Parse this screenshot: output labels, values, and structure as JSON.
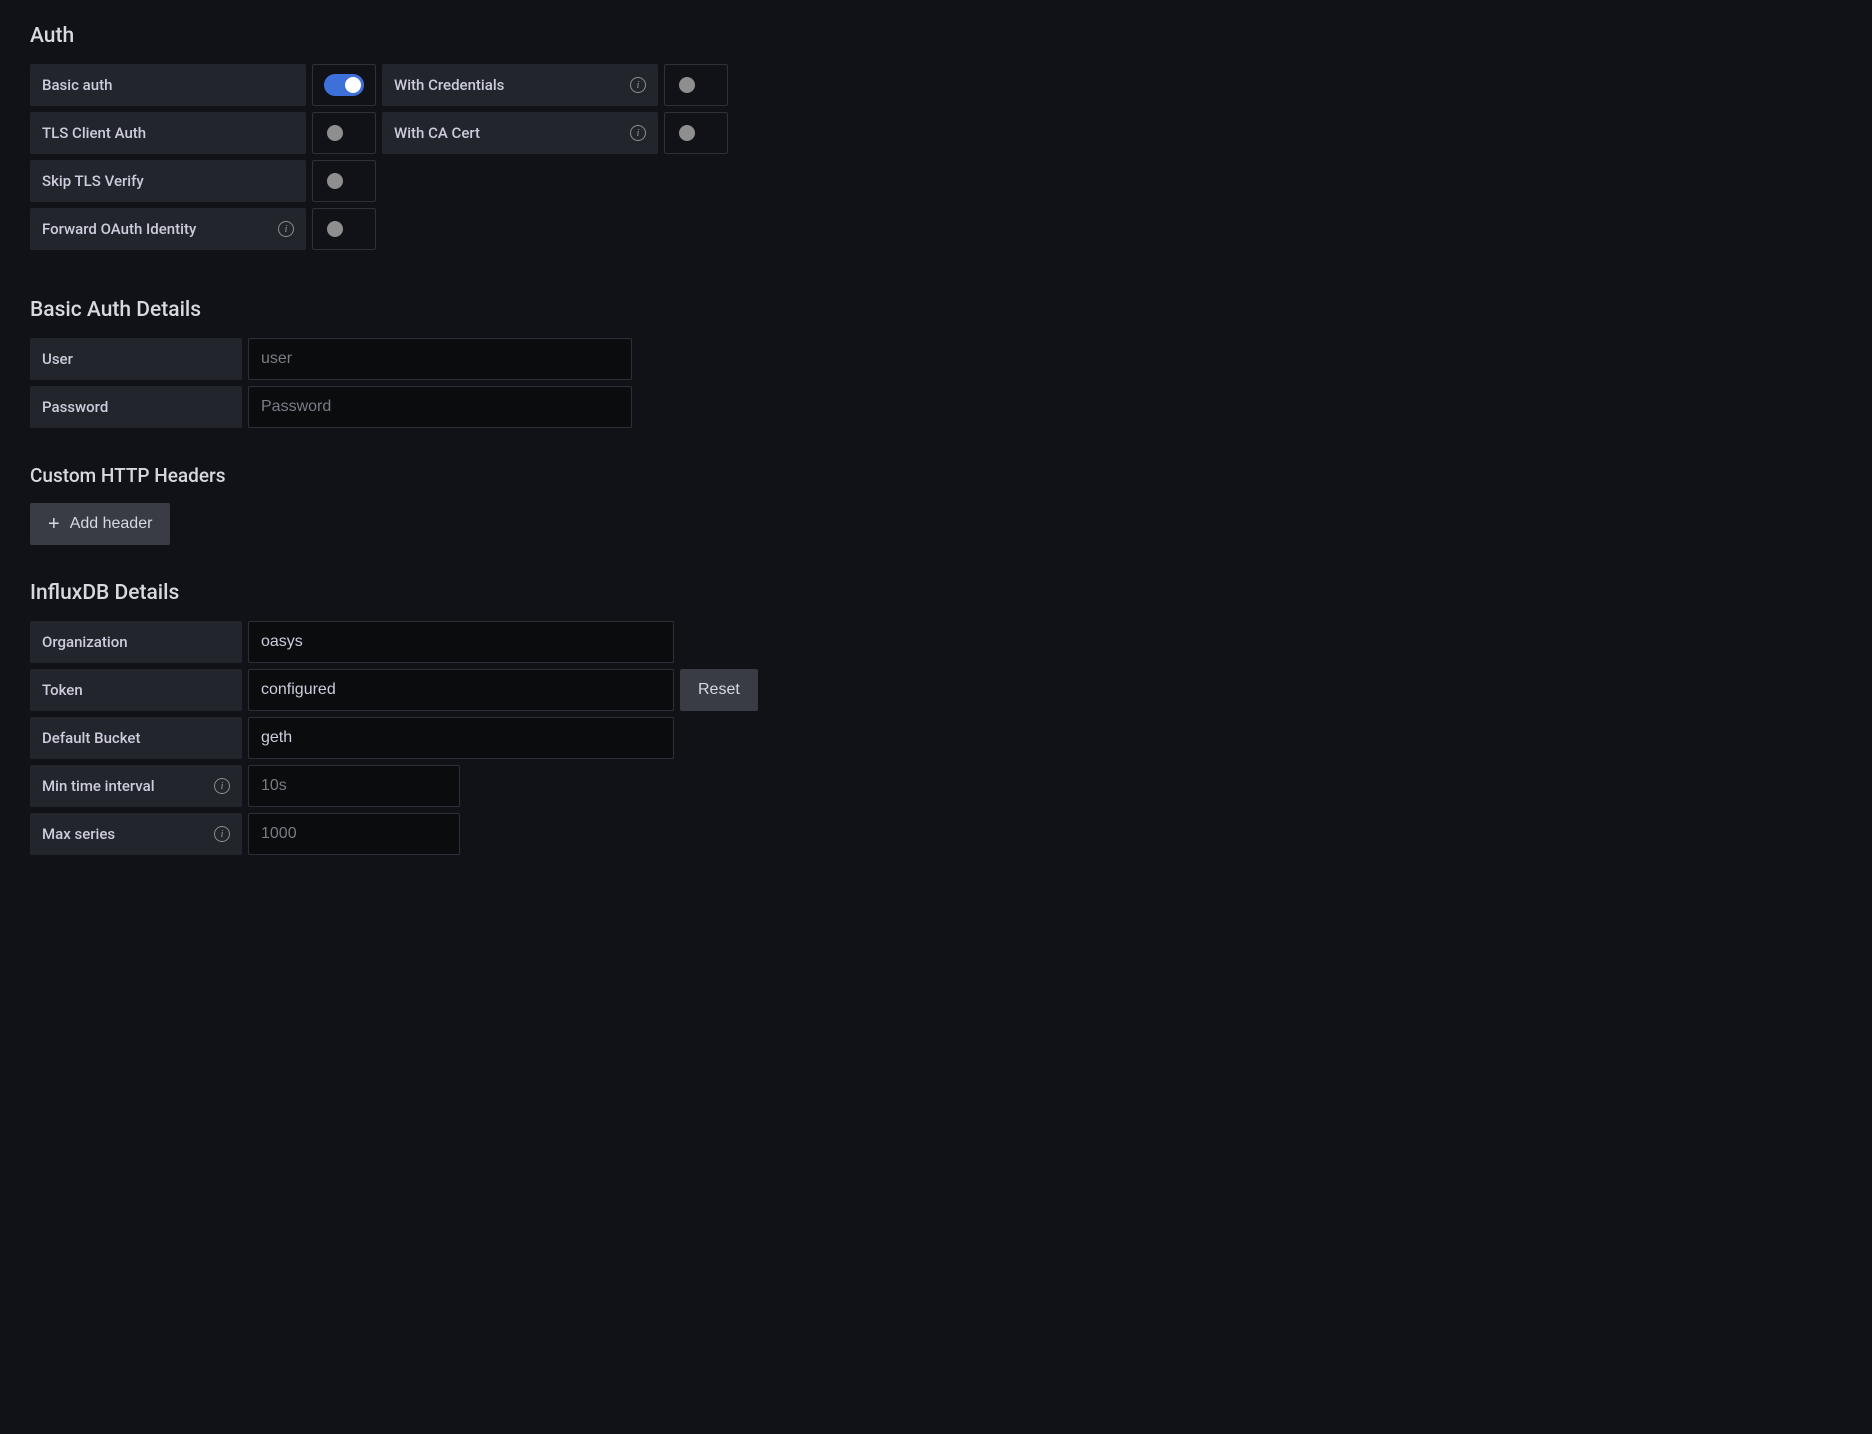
{
  "auth": {
    "title": "Auth",
    "rows": {
      "basic_auth": {
        "label": "Basic auth",
        "on": true
      },
      "tls_client_auth": {
        "label": "TLS Client Auth",
        "on": false
      },
      "skip_tls_verify": {
        "label": "Skip TLS Verify",
        "on": false
      },
      "forward_oauth": {
        "label": "Forward OAuth Identity",
        "on": false
      },
      "with_credentials": {
        "label": "With Credentials",
        "on": false
      },
      "with_ca_cert": {
        "label": "With CA Cert",
        "on": false
      }
    }
  },
  "basic_auth_details": {
    "title": "Basic Auth Details",
    "user": {
      "label": "User",
      "placeholder": "user",
      "value": ""
    },
    "password": {
      "label": "Password",
      "placeholder": "Password",
      "value": ""
    }
  },
  "custom_headers": {
    "title": "Custom HTTP Headers",
    "add_button": "Add header"
  },
  "influx": {
    "title": "InfluxDB Details",
    "organization": {
      "label": "Organization",
      "value": "oasys"
    },
    "token": {
      "label": "Token",
      "value": "configured",
      "reset_button": "Reset"
    },
    "default_bucket": {
      "label": "Default Bucket",
      "value": "geth"
    },
    "min_time_interval": {
      "label": "Min time interval",
      "placeholder": "10s",
      "value": ""
    },
    "max_series": {
      "label": "Max series",
      "placeholder": "1000",
      "value": ""
    }
  }
}
